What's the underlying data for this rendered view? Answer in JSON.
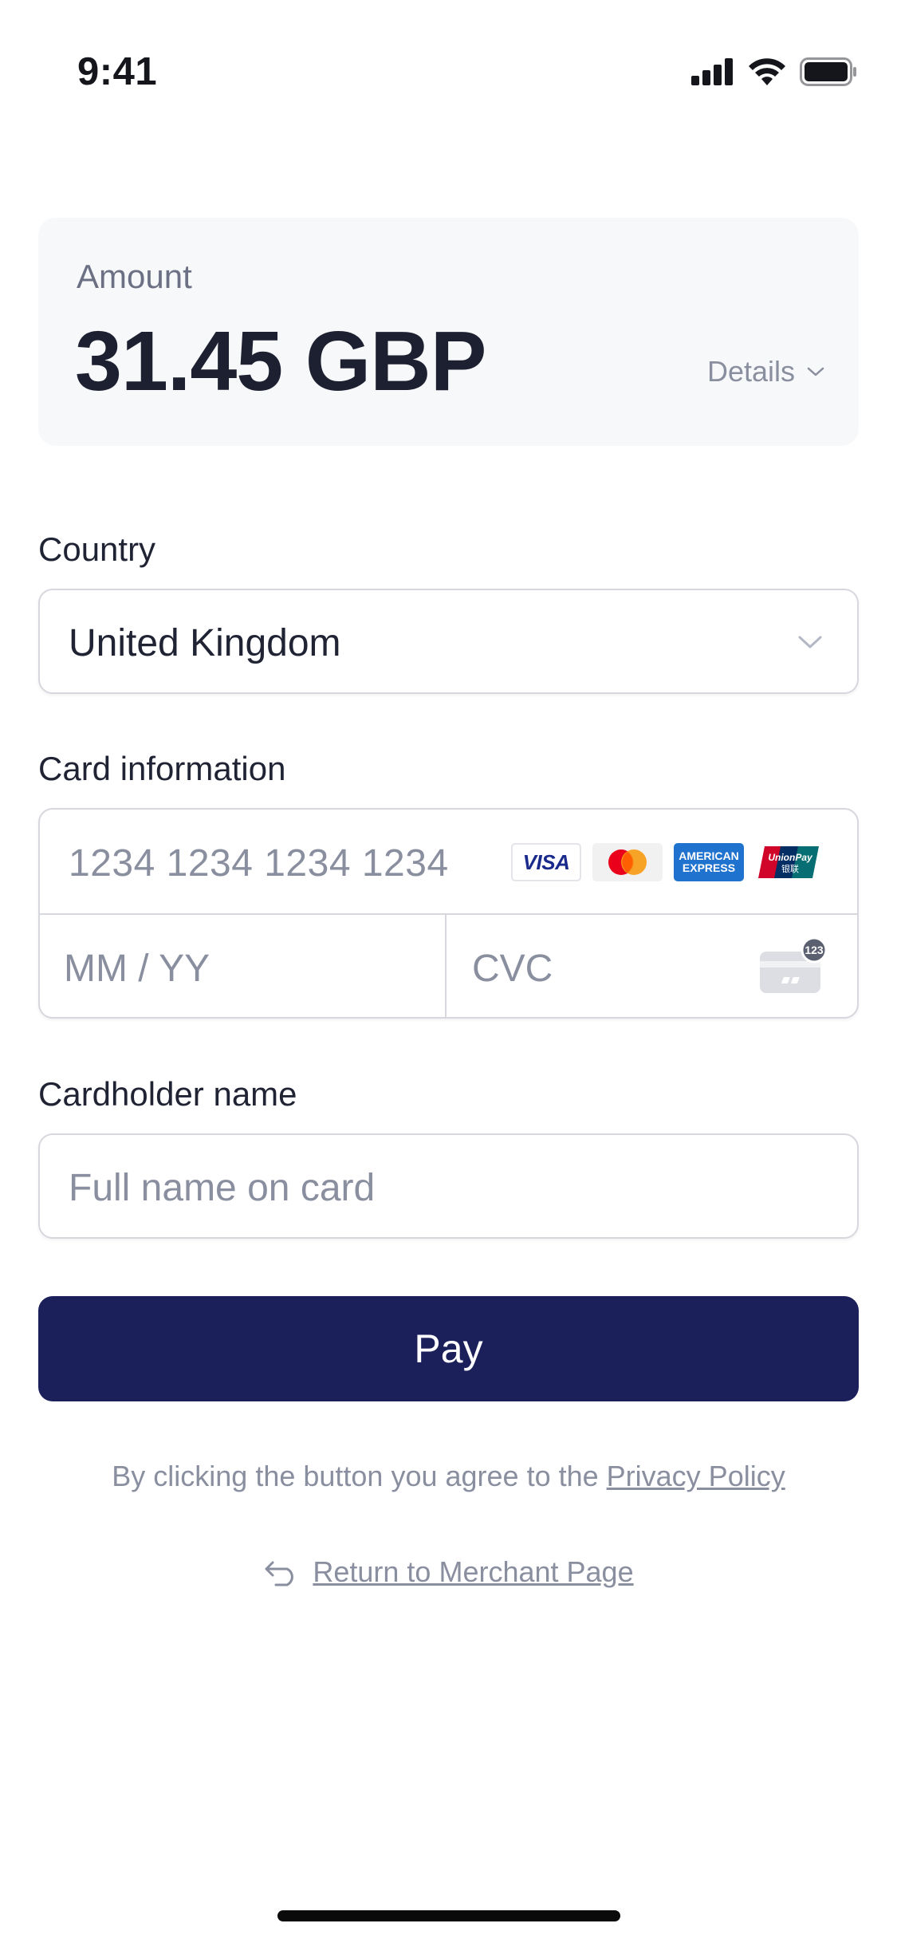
{
  "status_bar": {
    "time": "9:41",
    "icons": [
      "cellular-signal-icon",
      "wifi-icon",
      "battery-icon"
    ]
  },
  "amount": {
    "label": "Amount",
    "value": "31.45 GBP",
    "details_label": "Details"
  },
  "country": {
    "label": "Country",
    "selected": "United Kingdom"
  },
  "card_information": {
    "label": "Card information",
    "number_placeholder": "1234 1234 1234 1234",
    "expiry_placeholder": "MM / YY",
    "cvc_placeholder": "CVC",
    "cvc_badge": "123",
    "brands": [
      "VISA",
      "Mastercard",
      "AMERICAN EXPRESS",
      "UnionPay"
    ]
  },
  "cardholder": {
    "label": "Cardholder name",
    "placeholder": "Full name on card"
  },
  "pay_button": {
    "label": "Pay"
  },
  "consent": {
    "text": "By clicking the button you agree to the ",
    "link": "Privacy Policy"
  },
  "return_link": {
    "label": "Return to Merchant Page"
  },
  "colors": {
    "primary": "#1b1f5a",
    "muted_text": "#8a8fa0",
    "border": "#d6d8de",
    "card_bg": "#f7f8f9"
  }
}
